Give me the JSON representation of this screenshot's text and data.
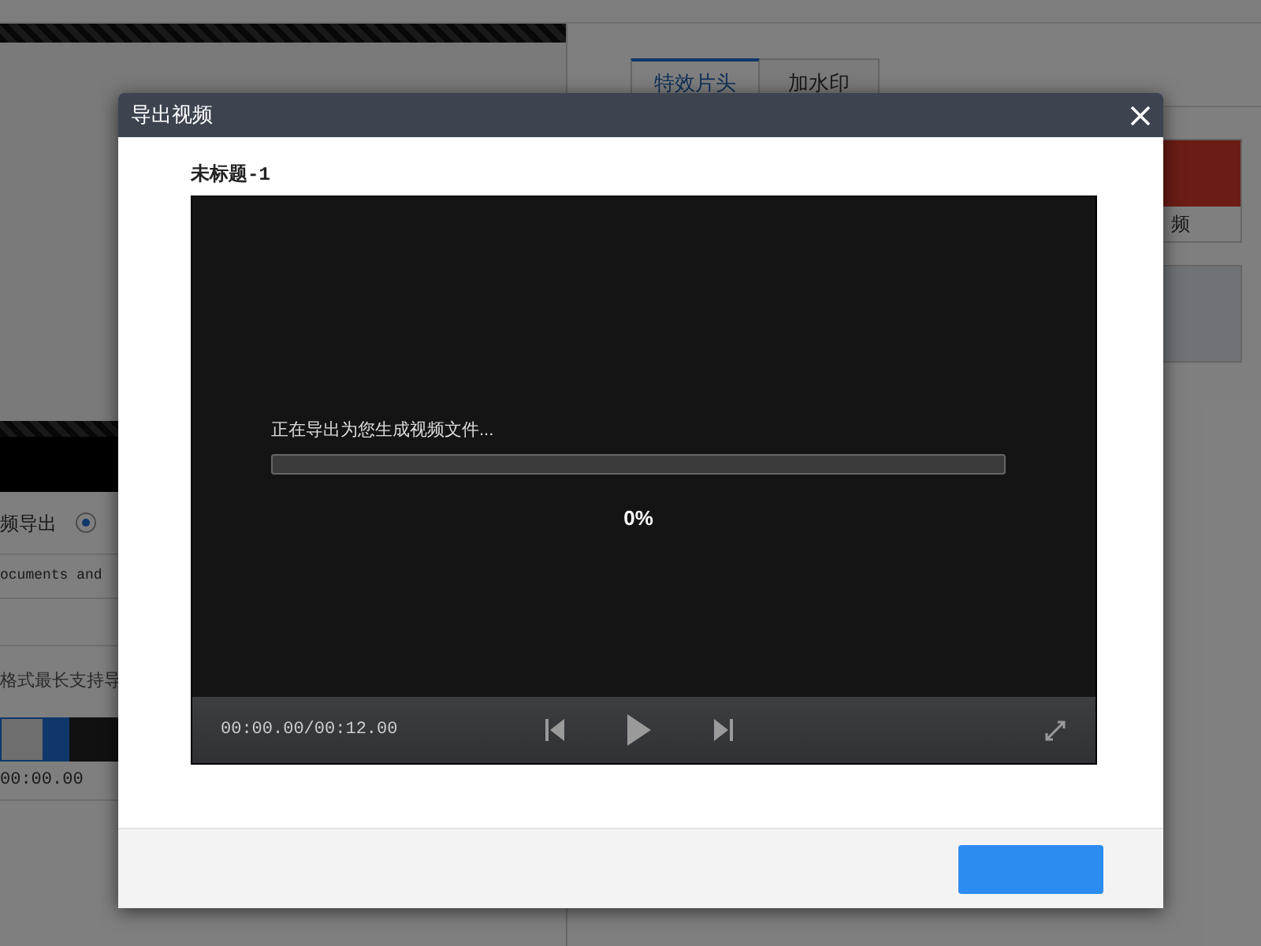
{
  "background": {
    "tabs": [
      {
        "label": "特效片头",
        "selected": true
      },
      {
        "label": "加水印",
        "selected": false
      }
    ],
    "export_mode_label": "频导出",
    "export_mode_selected": true,
    "path_value": "ocuments and",
    "format_note": "格式最长支持导",
    "time_value": "00:00.00",
    "thumbnail_caption": "频"
  },
  "dialog": {
    "title": "导出视频",
    "project_name": "未标题-1",
    "player": {
      "status_text": "正在导出为您生成视频文件...",
      "level": 0,
      "percent": "0%",
      "time": "00:00.00/00:12.00"
    }
  }
}
